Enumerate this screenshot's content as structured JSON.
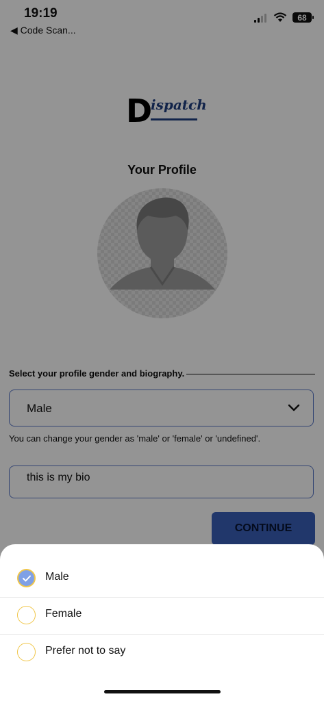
{
  "status_bar": {
    "time": "19:19",
    "back_label": "◀ Code Scan...",
    "battery": "68"
  },
  "logo": {
    "letter": "D",
    "rest": "ispatch"
  },
  "page_title": "Your Profile",
  "form": {
    "section_label": "Select your profile gender and biography.",
    "gender_value": "Male",
    "gender_hint": "You can change your gender as 'male' or 'female' or 'undefined'.",
    "bio_value": "this is my bio",
    "continue_label": "CONTINUE"
  },
  "sheet": {
    "options": [
      {
        "label": "Male",
        "selected": true
      },
      {
        "label": "Female",
        "selected": false
      },
      {
        "label": "Prefer not to say",
        "selected": false
      }
    ]
  },
  "colors": {
    "accent": "#3a5fb8",
    "radio_border": "#f0c64a",
    "radio_checked_fill": "#7fa0e6"
  }
}
